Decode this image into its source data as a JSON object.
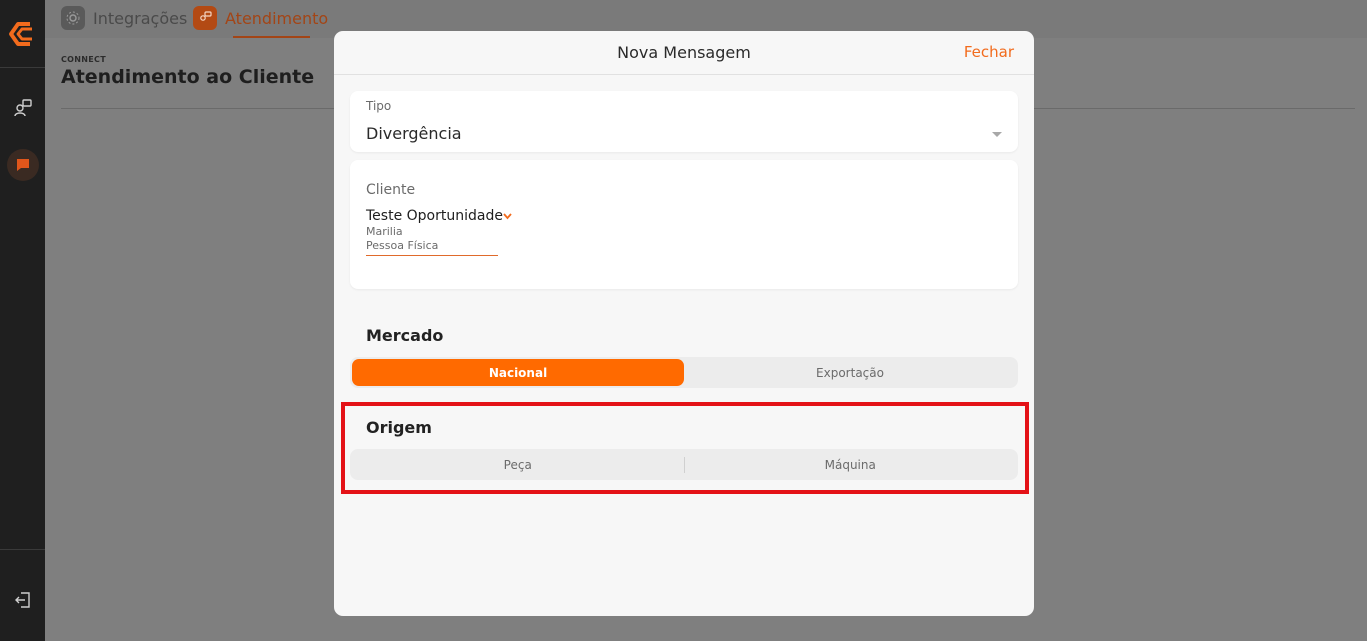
{
  "sidebar": {
    "logo_icon": "brand-logo-icon",
    "items": [
      {
        "icon": "people-icon"
      },
      {
        "icon": "chat-icon"
      }
    ],
    "exit_icon": "logout-icon"
  },
  "topnav": {
    "items": [
      {
        "label": "Integrações",
        "icon": "integrations-icon"
      },
      {
        "label": "Atendimento",
        "icon": "atendimento-icon"
      }
    ]
  },
  "page": {
    "breadcrumb": "CONNECT",
    "title": "Atendimento ao Cliente"
  },
  "modal": {
    "title": "Nova Mensagem",
    "close_label": "Fechar",
    "tipo": {
      "label": "Tipo",
      "value": "Divergência"
    },
    "cliente": {
      "label": "Cliente",
      "name": "Teste Oportunidade",
      "line1": "Marilia",
      "line2": "Pessoa Física"
    },
    "mercado": {
      "title": "Mercado",
      "options": [
        "Nacional",
        "Exportação"
      ],
      "selected": "Nacional"
    },
    "origem": {
      "title": "Origem",
      "options": [
        "Peça",
        "Máquina"
      ]
    }
  },
  "colors": {
    "accent": "#ff6a00",
    "highlight": "#e41217",
    "sidebar": "#1f1f1f"
  }
}
